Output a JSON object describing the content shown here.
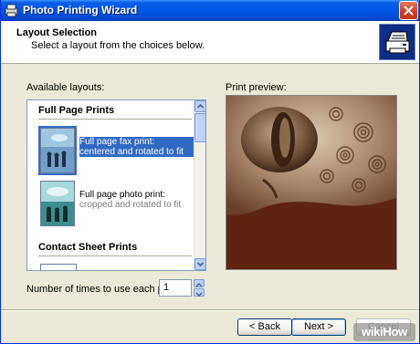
{
  "window": {
    "title": "Photo Printing Wizard"
  },
  "header": {
    "title": "Layout Selection",
    "subtitle": "Select a layout from the choices below."
  },
  "layouts": {
    "label": "Available layouts:",
    "groups": [
      {
        "name": "Full Page Prints",
        "items": [
          {
            "line1": "Full page fax print:",
            "line2": "centered and rotated to fit",
            "selected": true
          },
          {
            "line1": "Full page photo print:",
            "line2": "cropped and rotated to fit",
            "selected": false
          }
        ]
      },
      {
        "name": "Contact Sheet Prints",
        "items": []
      }
    ]
  },
  "preview": {
    "label": "Print preview:"
  },
  "copies": {
    "label": "Number of times to use each picture:",
    "value": "1"
  },
  "buttons": {
    "back": "< Back",
    "next": "Next >",
    "cancel": "Cancel"
  },
  "watermark": "wikiHow",
  "colors": {
    "titlebar": "#0055e5",
    "selection": "#316ac5",
    "window_bg": "#ece9d8",
    "close_button": "#d6391a"
  }
}
